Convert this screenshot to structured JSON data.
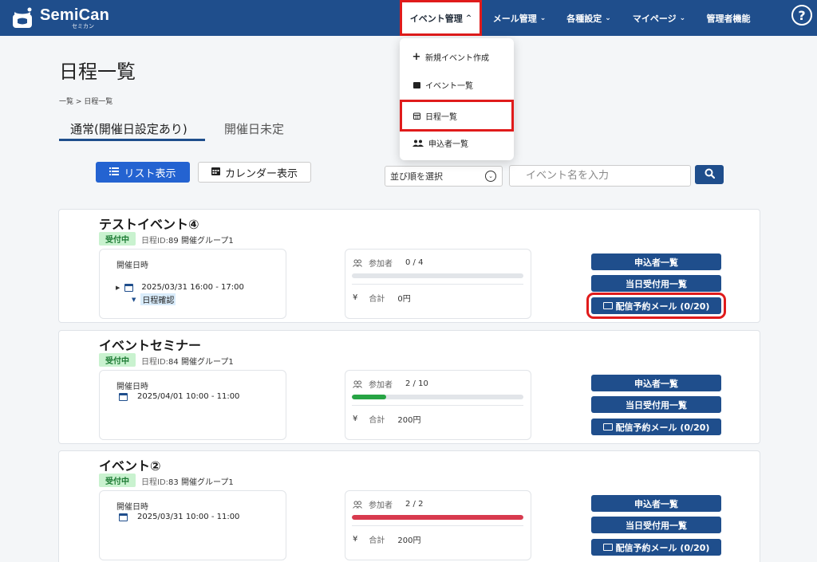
{
  "header": {
    "logo_text": "SemiCan",
    "logo_sub": "セミカン",
    "nav": [
      {
        "label": "イベント管理",
        "active": true
      },
      {
        "label": "メール管理"
      },
      {
        "label": "各種設定"
      },
      {
        "label": "マイページ"
      },
      {
        "label": "管理者機能"
      }
    ],
    "help": "?"
  },
  "dropdown": {
    "items": [
      {
        "label": "新規イベント作成",
        "icon": "plus-icon"
      },
      {
        "label": "イベント一覧",
        "icon": "calendar-icon"
      },
      {
        "label": "日程一覧",
        "icon": "calendar-grid-icon",
        "highlighted": true
      },
      {
        "label": "申込者一覧",
        "icon": "users-icon"
      }
    ]
  },
  "page": {
    "title": "日程一覧",
    "breadcrumb": "一覧  >  日程一覧",
    "tabs": [
      {
        "label": "通常(開催日設定あり)",
        "active": true
      },
      {
        "label": "開催日未定"
      }
    ],
    "view_list": "リスト表示",
    "view_calendar": "カレンダー表示",
    "sort_placeholder": "並び順を選択",
    "search_placeholder": "イベント名を入力"
  },
  "colors": {
    "brand": "#1f4e8c",
    "primary": "#2463d1",
    "highlight": "#e01b1b",
    "progress_green": "#27a444",
    "progress_red": "#d83a4e"
  },
  "labels": {
    "date_label": "開催日時",
    "participants": "参加者",
    "total": "合計",
    "yen": "¥",
    "schedule_confirm": "日程確認",
    "btn_applicants": "申込者一覧",
    "btn_sameday": "当日受付用一覧",
    "btn_mail": "配信予約メール (0/20)"
  },
  "events": [
    {
      "title": "テストイベント④",
      "status": "受付中",
      "schedule_id_label": "日程ID:",
      "schedule_id": "89",
      "group": "開催グループ1",
      "datetime": "2025/03/31 16:00 - 17:00",
      "participants": "0 /  4",
      "progress": 0,
      "total": "0円"
    },
    {
      "title": "イベントセミナー",
      "status": "受付中",
      "schedule_id_label": "日程ID:",
      "schedule_id": "84",
      "group": "開催グループ1",
      "datetime": "2025/04/01 10:00 - 11:00",
      "participants": "2 /  10",
      "progress": 0.2,
      "total": "200円"
    },
    {
      "title": "イベント②",
      "status": "受付中",
      "schedule_id_label": "日程ID:",
      "schedule_id": "83",
      "group": "開催グループ1",
      "datetime": "2025/03/31 10:00 - 11:00",
      "participants": "2 /  2",
      "progress": 1,
      "total": "200円"
    }
  ]
}
